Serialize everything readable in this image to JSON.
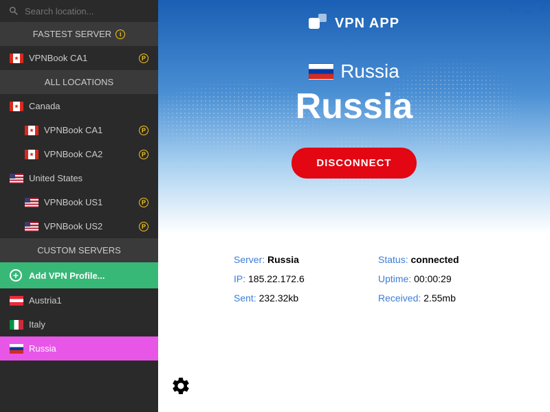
{
  "search": {
    "placeholder": "Search location..."
  },
  "sections": {
    "fastest": "FASTEST SERVER",
    "all": "ALL LOCATIONS",
    "custom": "CUSTOM SERVERS"
  },
  "fastest_server": {
    "name": "VPNBook CA1"
  },
  "locations": {
    "canada": {
      "name": "Canada",
      "servers": [
        "VPNBook CA1",
        "VPNBook CA2"
      ]
    },
    "us": {
      "name": "United States",
      "servers": [
        "VPNBook US1",
        "VPNBook US2"
      ]
    }
  },
  "add_profile": "Add VPN Profile...",
  "custom_servers": {
    "austria": "Austria1",
    "italy": "Italy",
    "russia": "Russia"
  },
  "app_name": "VPN APP",
  "connected": {
    "country": "Russia",
    "country_big": "Russia"
  },
  "disconnect": "DISCONNECT",
  "stats": {
    "server_label": "Server:",
    "server_value": "Russia",
    "status_label": "Status:",
    "status_value": "connected",
    "ip_label": "IP:",
    "ip_value": "185.22.172.6",
    "uptime_label": "Uptime:",
    "uptime_value": "00:00:29",
    "sent_label": "Sent:",
    "sent_value": "232.32kb",
    "received_label": "Received:",
    "received_value": "2.55mb"
  }
}
